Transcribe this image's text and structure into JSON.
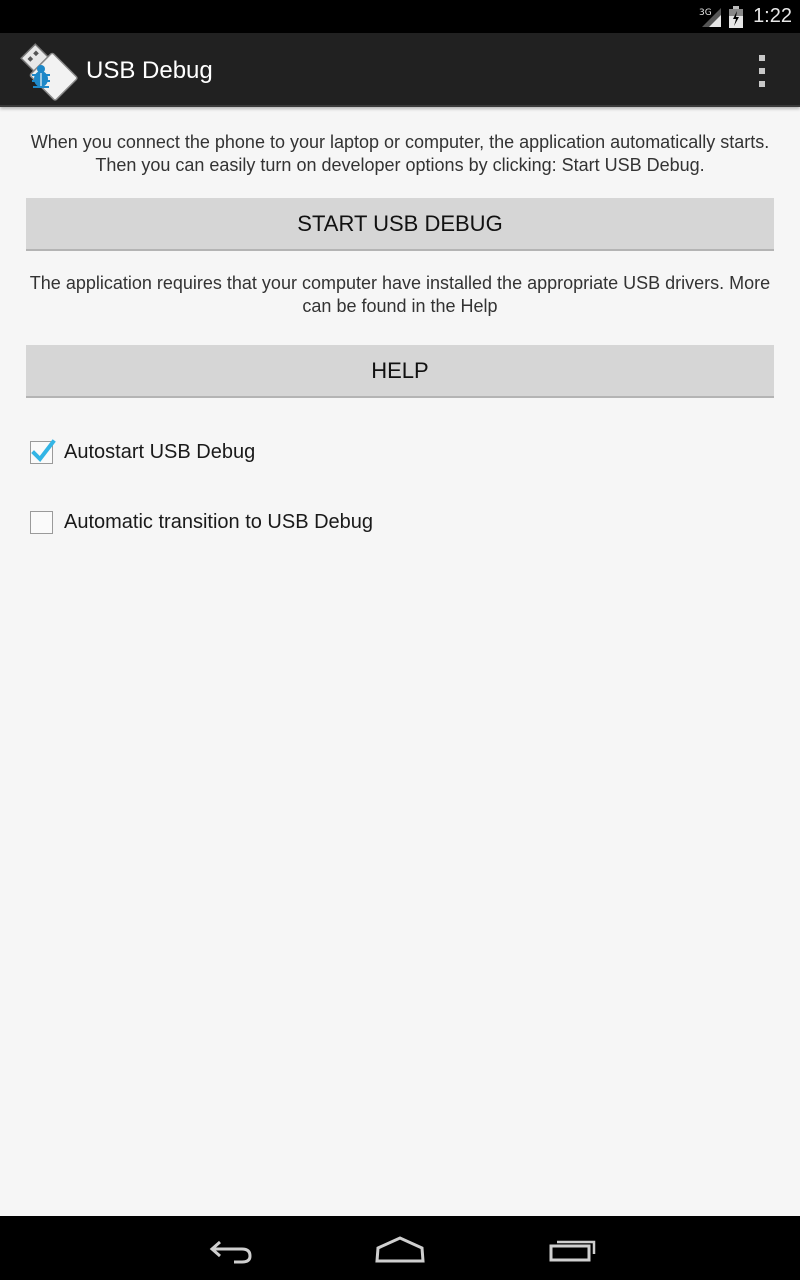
{
  "status_bar": {
    "network": "3G",
    "time": "1:22"
  },
  "action_bar": {
    "title": "USB Debug",
    "app_icon": "usb-bug-icon",
    "overflow_icon": "overflow-menu-icon"
  },
  "main": {
    "intro_text": "When you connect the phone to your laptop or computer, the application automatically starts. Then you can easily turn on developer options by clicking: Start USB Debug.",
    "start_button_label": "START USB DEBUG",
    "drivers_text": "The application requires that your computer have installed the appropriate USB drivers. More can be found in the Help",
    "help_button_label": "HELP",
    "checkboxes": [
      {
        "label": "Autostart USB Debug",
        "checked": true
      },
      {
        "label": "Automatic transition to USB Debug",
        "checked": false
      }
    ]
  },
  "nav_bar": {
    "back_icon": "back-icon",
    "home_icon": "home-icon",
    "recents_icon": "recents-icon"
  },
  "colors": {
    "accent": "#33b5e5",
    "action_bar": "#212121",
    "background": "#f6f6f6",
    "button": "#d6d6d6"
  }
}
